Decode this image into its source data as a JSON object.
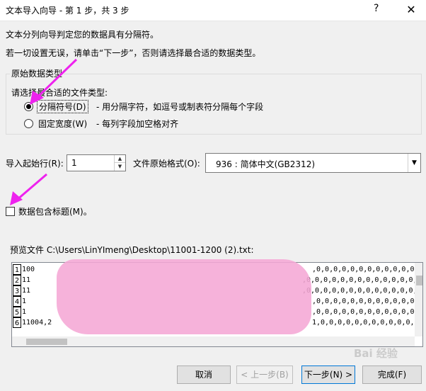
{
  "window": {
    "title": "文本导入向导 - 第 1 步，共 3 步",
    "help_label": "?",
    "close_label": "✕"
  },
  "intro": {
    "line1": "文本分列向导判定您的数据具有分隔符。",
    "line2": "若一切设置无误，请单击“下一步”，否则请选择最合适的数据类型。"
  },
  "original_type_group": {
    "legend": "原始数据类型",
    "prompt": "请选择最合适的文件类型:",
    "options": [
      {
        "label": "分隔符号(D)",
        "description": "- 用分隔字符，如逗号或制表符分隔每个字段",
        "selected": true
      },
      {
        "label": "固定宽度(W)",
        "description": "- 每列字段加空格对齐",
        "selected": false
      }
    ]
  },
  "import_start": {
    "label": "导入起始行(R):",
    "value": "1",
    "spin_up": "▲",
    "spin_down": "▼"
  },
  "file_origin": {
    "label": "文件原始格式(O):",
    "value": "936 : 简体中文(GB2312)",
    "dropdown_icon": "▼"
  },
  "header_checkbox": {
    "label": "数据包含标题(M)。",
    "checked": false
  },
  "preview": {
    "label": "预览文件 C:\\Users\\LinYImeng\\Desktop\\11001-1200 (2).txt:",
    "rows": [
      {
        "num": "1",
        "text": "100",
        "tail": ",0,0,0,0,0,0,0,0,0,0,0,0,0,0"
      },
      {
        "num": "2",
        "text": "11",
        "tail": ",0,0,0,0,0,0,0,0,0,0,0,0,0,0"
      },
      {
        "num": "3",
        "text": "11",
        "tail": ",0,0,0,0,0,0,0,0,0,0,0,0,0,0"
      },
      {
        "num": "4",
        "text": "1",
        "tail": ",0,0,0,0,0,0,0,0,0,0,0,0,0,0"
      },
      {
        "num": "5",
        "text": "1",
        "tail": ",0,0,0,0,0,0,0,0,0,0,0,0,0,0"
      },
      {
        "num": "6",
        "text": "11004,2",
        "tail": "1,0,0,0,0,0,0,0,0,0,0,0,0,0"
      }
    ]
  },
  "buttons": {
    "cancel": "取消",
    "prev": "< 上一步(B)",
    "next": "下一步(N) >",
    "finish": "完成(F)"
  },
  "colors": {
    "annotation_arrow": "#ee22ee",
    "redaction": "#f5a7d5",
    "accent": "#0078d7"
  },
  "watermark": "Bai 经验"
}
